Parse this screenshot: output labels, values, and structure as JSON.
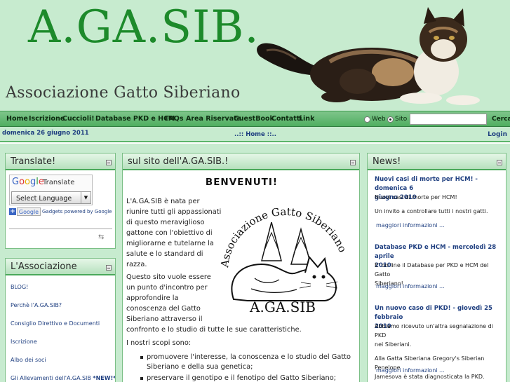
{
  "header": {
    "logo": "A.GA.SIB.",
    "subtitle": "Associazione Gatto Siberiano"
  },
  "menu": [
    "Home",
    "Iscrizione",
    "Cuccioli!",
    "Database PKD e HCM",
    "FAQs",
    "Area Riservata",
    "GuestBook",
    "Contatti",
    "Link"
  ],
  "search": {
    "option_web": "Web",
    "option_site": "Sito",
    "selected": "Sito",
    "value": "",
    "button": "Cerca"
  },
  "infobar": {
    "date": "domenica 26 giugno 2011",
    "breadcrumb": "..:: Home ::..",
    "login": "Login"
  },
  "translate": {
    "title": "Translate!",
    "google": "Google",
    "translate_label": "Translate",
    "select_label": "Select Language",
    "gadget_button": "Google",
    "powered": "Gadgets powered by Google"
  },
  "association": {
    "title": "L'Associazione",
    "links": [
      "BLOG!",
      "Perchè l'A.GA.SIB?",
      "Consiglio Direttivo e Documenti",
      "Iscrizione",
      "Albo dei soci",
      "Gli Allevamenti dell'A.GA.SIB "
    ],
    "new_badge": "*NEW!*"
  },
  "center": {
    "title": "sul sito dell'A.GA.SIB.!",
    "welcome": "BENVENUTI!",
    "para1": [
      "L'A.GA.SIB è nata per",
      "riunire tutti gli appassionati",
      "di questo meraviglioso",
      "gattone con l'obiettivo di",
      "migliorarne e tutelarne la",
      "salute e lo standard di",
      "razza."
    ],
    "para2": [
      "Questo sito vuole essere",
      "un punto d'incontro per",
      "approfondire la",
      "conoscenza del Gatto",
      "Siberiano attraverso il",
      "confronto e lo studio di tutte le sue caratteristiche."
    ],
    "scopi": "I nostri scopi sono:",
    "bullets": [
      "promuovere l'interesse, la conoscenza e lo studio del Gatto",
      "Siberiano e della sua genetica;",
      "preservare il genotipo e il fenotipo del Gatto Siberiano;"
    ],
    "stamp": {
      "arc": "Associazione Gatto Siberiano",
      "bottom": "A.GA.SIB"
    }
  },
  "news": {
    "title": "News!",
    "items": [
      {
        "title": [
          "Nuovi casi di morte per HCM! - domenica 6",
          "giugno 2010"
        ],
        "text": [
          "Nuovi casi di morte per HCM!",
          "",
          "Un invito a controllare tutti i nostri gatti."
        ],
        "more": "maggiori informazioni ..."
      },
      {
        "title": [
          "Database PKD e HCM - mercoledì 28 aprile",
          "2010"
        ],
        "text": [
          "E' on line il Database per PKD e HCM del Gatto",
          "Siberiano!"
        ],
        "more": "maggiori informazioni ..."
      },
      {
        "title": [
          "Un nuovo caso di PKD! - giovedì 25 febbraio",
          "2010"
        ],
        "text": [
          "Abbiamo ricevuto un'altra segnalazione di PKD",
          "nei Siberiani.",
          "",
          "Alla Gatta Siberiana Gregory's Siberian Penelope",
          "Jamesova è stata diagnosticata la PKD."
        ],
        "more": "maggiori informazioni ..."
      }
    ]
  },
  "colors": {
    "header_bg": "#c7ebcf",
    "logo_green": "#1d8a2b",
    "menu_green": "#4fae60",
    "link_blue": "#1f3f80"
  }
}
